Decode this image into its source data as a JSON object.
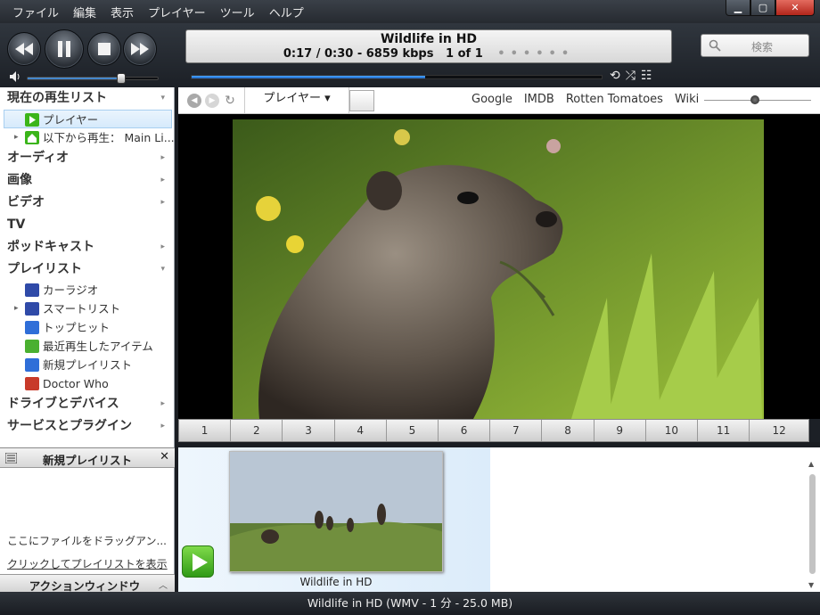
{
  "menu": [
    "ファイル",
    "編集",
    "表示",
    "プレイヤー",
    "ツール",
    "ヘルプ"
  ],
  "window_controls": {
    "minimize": "▁",
    "maximize": "▢",
    "close": "✕"
  },
  "now_playing": {
    "title": "Wildlife in HD",
    "time": "0:17 / 0:30 - 6859 kbps",
    "position": "1 of 1",
    "progress": 0.57
  },
  "volume": 0.72,
  "search": {
    "placeholder": "検索"
  },
  "sidebar": {
    "sections": [
      {
        "label": "現在の再生リスト",
        "arrow": "▾"
      },
      {
        "label": "プレイヤー",
        "icon": "play-icon",
        "color": "#3bb51a"
      },
      {
        "label": "以下から再生： Main Li...",
        "icon": "home-icon",
        "color": "#3bb51a"
      },
      {
        "label": "オーディオ",
        "arrow": "▸"
      },
      {
        "label": "画像",
        "arrow": "▸"
      },
      {
        "label": "ビデオ",
        "arrow": "▸"
      },
      {
        "label": "TV"
      },
      {
        "label": "ポッドキャスト",
        "arrow": "▸"
      },
      {
        "label": "プレイリスト",
        "arrow": "▾"
      },
      {
        "label": "カーラジオ",
        "icon": "playlist-icon",
        "color": "#2f4aa8"
      },
      {
        "label": "スマートリスト",
        "icon": "smartlist-icon",
        "color": "#2f4aa8"
      },
      {
        "label": "トップヒット",
        "icon": "playlist-icon",
        "color": "#2f6ed8"
      },
      {
        "label": "最近再生したアイテム",
        "icon": "playlist-icon",
        "color": "#4ab030"
      },
      {
        "label": "新規プレイリスト",
        "icon": "playlist-icon",
        "color": "#2f6ed8"
      },
      {
        "label": "Doctor Who",
        "icon": "tardis-icon",
        "color": "#c83a2a"
      },
      {
        "label": "ドライブとデバイス",
        "arrow": "▸"
      },
      {
        "label": "サービスとプラグイン",
        "arrow": "▸"
      }
    ]
  },
  "mini_playlist": {
    "title": "新規プレイリスト",
    "close": "✕",
    "drop_hint": "ここにファイルをドラッグアン...",
    "show_link": "クリックしてプレイリストを表示"
  },
  "action_window": {
    "title": "アクションウィンドウ",
    "toggle": "︿"
  },
  "nav": {
    "tab_label": "プレイヤー ▾",
    "links": [
      "Google",
      "IMDB",
      "Rotten Tomatoes",
      "Wiki"
    ]
  },
  "chapters": [
    "1",
    "2",
    "3",
    "4",
    "5",
    "6",
    "7",
    "8",
    "9",
    "10",
    "11",
    "12"
  ],
  "playlist_item": {
    "caption": "Wildlife in HD"
  },
  "status": "Wildlife in HD (WMV - 1 分 - 25.0 MB)"
}
